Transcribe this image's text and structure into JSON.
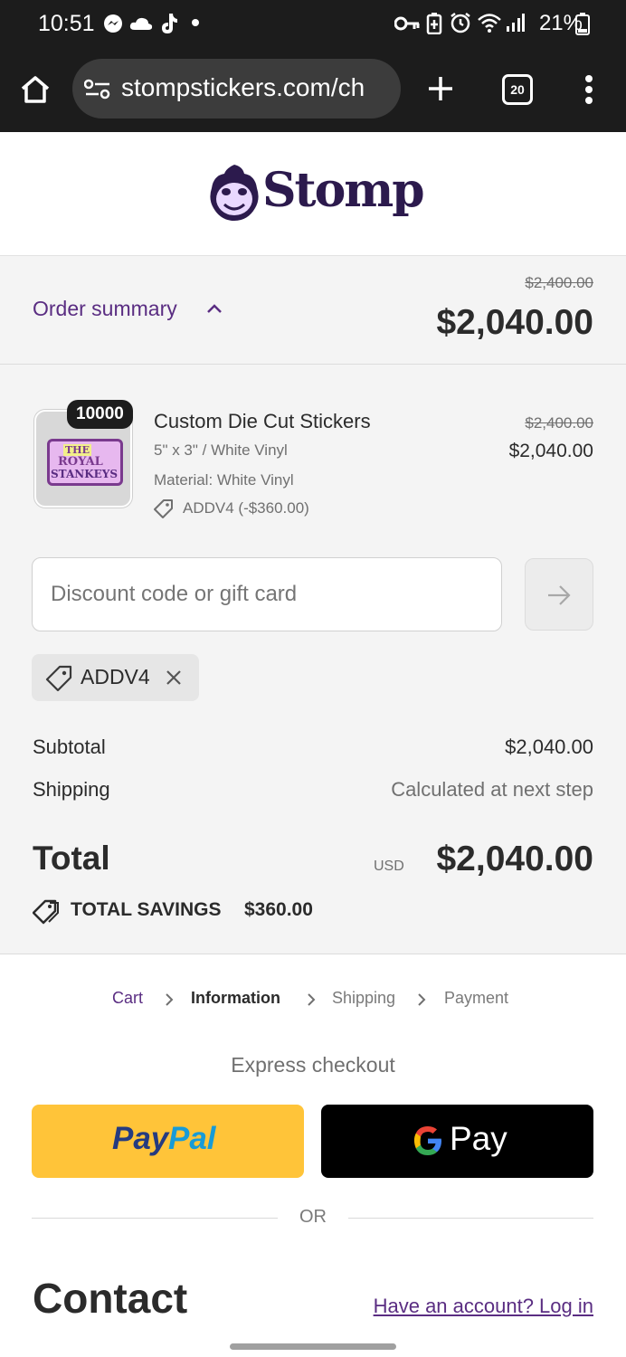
{
  "status_bar": {
    "time": "10:51",
    "battery": "21%",
    "icons": [
      "messenger-icon",
      "cloud-icon",
      "tiktok-icon",
      "dot-icon",
      "key-icon",
      "battery-saver-icon",
      "alarm-icon",
      "wifi-icon",
      "signal-icon",
      "battery-icon"
    ]
  },
  "browser": {
    "url": "stompstickers.com/ch",
    "tab_count": "20"
  },
  "brand": {
    "name": "Stomp",
    "tm": "™",
    "color": "#2c1a4d"
  },
  "summary": {
    "toggle_label": "Order summary",
    "original_total": "$2,400.00",
    "total": "$2,040.00"
  },
  "item": {
    "quantity": "10000",
    "title": "Custom Die Cut Stickers",
    "variant": "5\" x 3\" / White Vinyl",
    "material": "Material: White Vinyl",
    "discount": "ADDV4 (-$360.00)",
    "original_price": "$2,400.00",
    "price": "$2,040.00",
    "thumb_text_1": "THE",
    "thumb_text_2": "ROYAL",
    "thumb_text_3": "STANKEYS"
  },
  "discount_form": {
    "placeholder": "Discount code or gift card",
    "applied_code": "ADDV4"
  },
  "totals": {
    "subtotal_label": "Subtotal",
    "subtotal_value": "$2,040.00",
    "shipping_label": "Shipping",
    "shipping_value": "Calculated at next step",
    "total_label": "Total",
    "currency": "USD",
    "total_value": "$2,040.00",
    "savings_label": "TOTAL SAVINGS",
    "savings_value": "$360.00"
  },
  "breadcrumbs": [
    "Cart",
    "Information",
    "Shipping",
    "Payment"
  ],
  "express": {
    "heading": "Express checkout",
    "paypal_pay": "Pay",
    "paypal_pal": "Pal",
    "gpay_label": "Pay",
    "or": "OR"
  },
  "contact": {
    "heading": "Contact",
    "login_link": "Have an account? Log in"
  },
  "colors": {
    "accent_purple": "#5a2d82",
    "paypal_yellow": "#ffc439",
    "paypal_dark": "#253b80",
    "paypal_light": "#179bd7"
  }
}
